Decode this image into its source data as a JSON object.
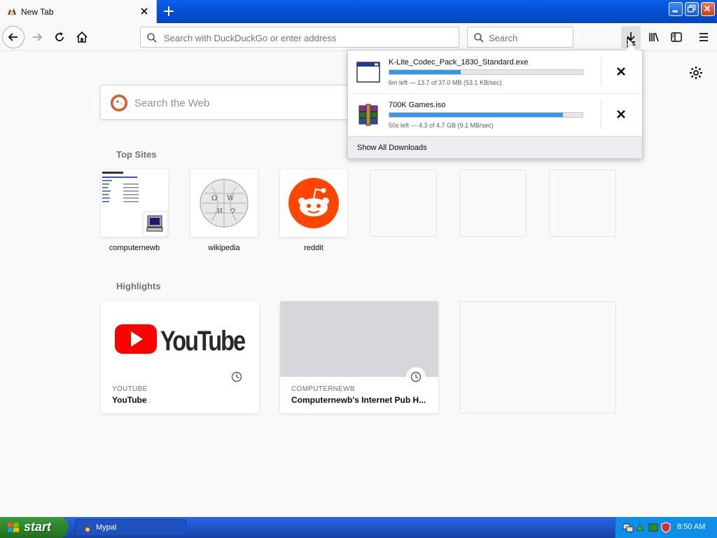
{
  "window": {
    "tab_title": "New Tab"
  },
  "toolbar": {
    "url_placeholder": "Search with DuckDuckGo or enter address",
    "search_placeholder": "Search"
  },
  "newtab": {
    "search_placeholder": "Search the Web",
    "top_sites_title": "Top Sites",
    "top_sites": [
      {
        "label": "computernewb"
      },
      {
        "label": "wikipedia"
      },
      {
        "label": "reddit"
      },
      {
        "label": ""
      },
      {
        "label": ""
      },
      {
        "label": ""
      }
    ],
    "highlights_title": "Highlights",
    "highlights": [
      {
        "source": "YOUTUBE",
        "title": "YouTube",
        "logo_text": "YouTube"
      },
      {
        "source": "COMPUTERNEWB",
        "title": "Computernewb's Internet Pub H..."
      }
    ]
  },
  "downloads": {
    "items": [
      {
        "name": "K-Lite_Codec_Pack_1830_Standard.exe",
        "progress": 0.37,
        "status": "6m left — 13.7 of 37.0 MB (53.1 KB/sec)"
      },
      {
        "name": "700K Games.iso",
        "progress": 0.9,
        "status": "50s left — 4.3 of 4.7 GB (9.1 MB/sec)"
      }
    ],
    "show_all": "Show All Downloads"
  },
  "taskbar": {
    "start_label": "start",
    "task_label": "Mypal",
    "clock": "8:50 AM"
  },
  "colors": {
    "accent": "#0a84ff",
    "progress": "#3b96e8",
    "reddit": "#ff4500",
    "youtube": "#ff0000"
  }
}
